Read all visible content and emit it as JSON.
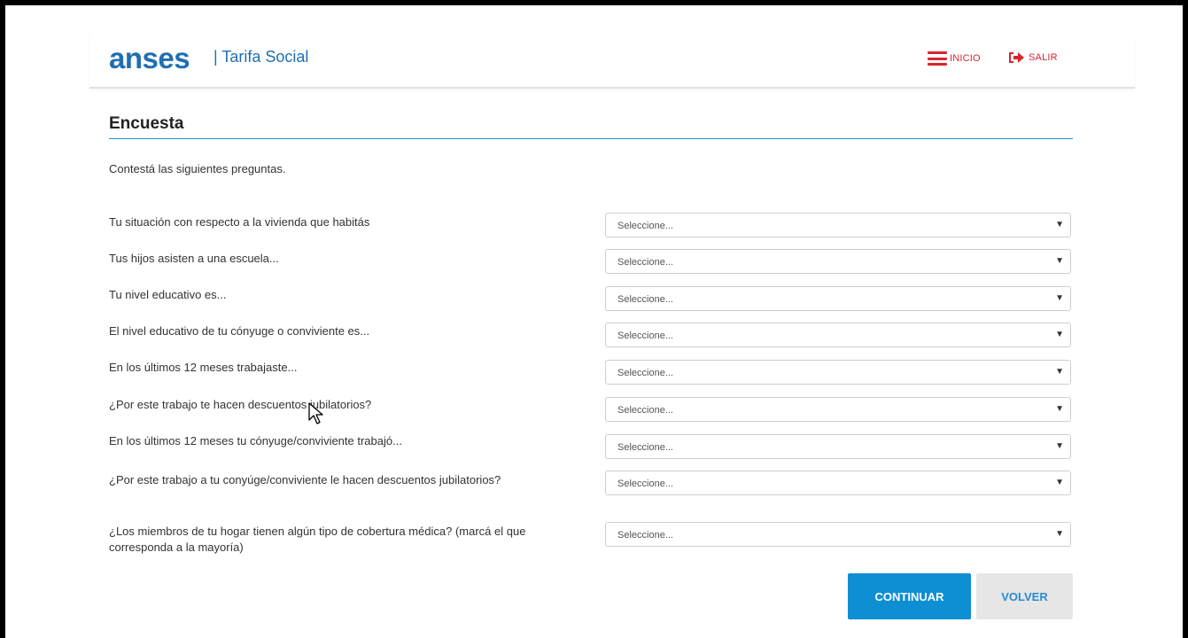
{
  "header": {
    "logo_text": "anses",
    "subtitle": "| Tarifa Social",
    "nav_inicio": "INICIO",
    "nav_salir": "SALIR",
    "accent_color": "#d8262e",
    "brand_color": "#1f6fb3"
  },
  "page": {
    "title": "Encuesta",
    "intro": "Contestá las siguientes preguntas."
  },
  "questions": [
    {
      "label": "Tu situación con respecto a la vivienda que habitás",
      "value": "Seleccione..."
    },
    {
      "label": "Tus hijos asisten a una escuela...",
      "value": "Seleccione..."
    },
    {
      "label": "Tu nivel educativo es...",
      "value": "Seleccione..."
    },
    {
      "label": "El nivel educativo de tu cónyuge o conviviente es...",
      "value": "Seleccione..."
    },
    {
      "label": "En los últimos 12 meses trabajaste...",
      "value": "Seleccione..."
    },
    {
      "label": "¿Por este trabajo te hacen descuentos jubilatorios?",
      "value": "Seleccione..."
    },
    {
      "label": "En los últimos 12 meses tu cónyuge/conviviente trabajó...",
      "value": "Seleccione..."
    },
    {
      "label": "¿Por este trabajo a tu conyúge/conviviente le hacen descuentos jubilatorios?",
      "value": "Seleccione..."
    },
    {
      "label": "¿Los miembros de tu hogar tienen algún tipo de cobertura médica? (marcá el que corresponda a la mayoría)",
      "value": "Seleccione..."
    }
  ],
  "buttons": {
    "continuar": "CONTINUAR",
    "volver": "VOLVER",
    "primary_color": "#0f8fd3"
  },
  "icons": {
    "menu": "hamburger-icon",
    "exit": "sign-out-icon",
    "dropdown": "triangle-down-icon",
    "pointer": "mouse-cursor-icon"
  }
}
